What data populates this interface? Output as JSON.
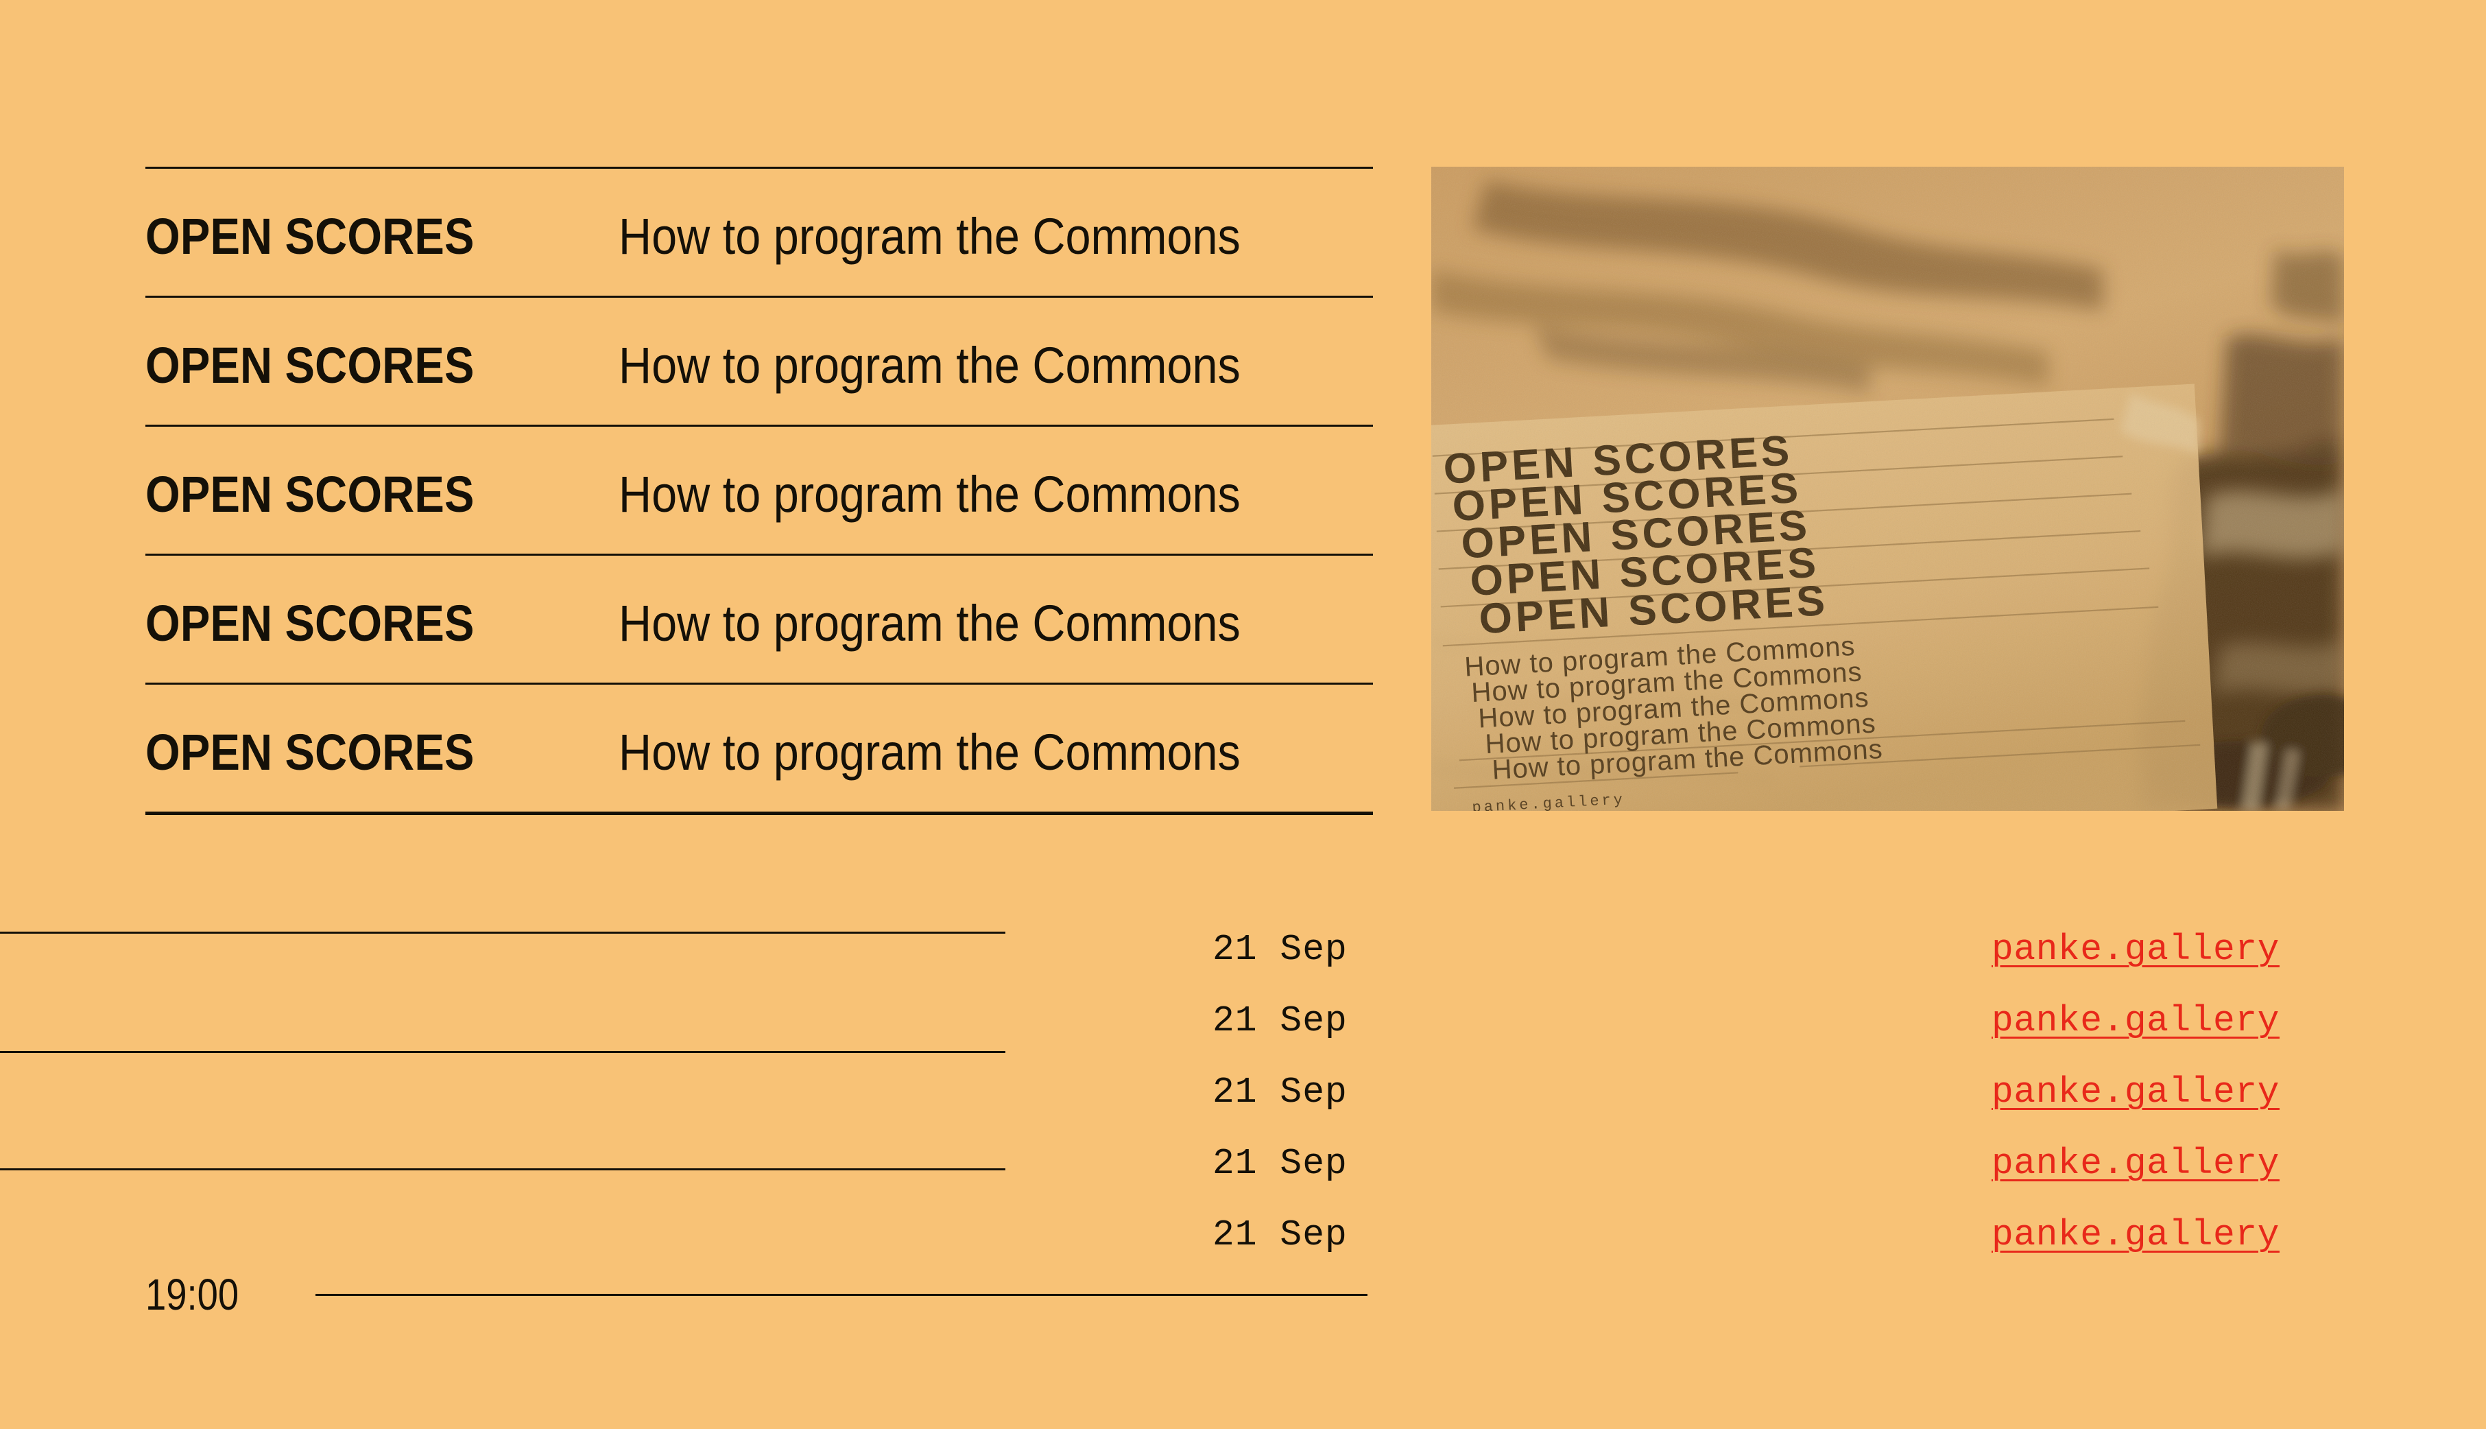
{
  "page": {
    "background_color": "#f8c276",
    "ink_color": "#141008",
    "accent_color": "#e8281a"
  },
  "masthead": {
    "rows": [
      {
        "title": "OPEN SCORES",
        "subtitle": "How to program the Commons"
      },
      {
        "title": "OPEN SCORES",
        "subtitle": "How to program the Commons"
      },
      {
        "title": "OPEN SCORES",
        "subtitle": "How to program the Commons"
      },
      {
        "title": "OPEN SCORES",
        "subtitle": "How to program the Commons"
      },
      {
        "title": "OPEN SCORES",
        "subtitle": "How to program the Commons"
      }
    ]
  },
  "photo": {
    "alt": "Sepia grainy photograph of a printed flyer lying on sand",
    "flyer_titles": [
      "OPEN SCORES",
      "OPEN SCORES",
      "OPEN SCORES",
      "OPEN SCORES",
      "OPEN SCORES"
    ],
    "flyer_subtitles": [
      "How to program the Commons",
      "How to program the Commons",
      "How to program the Commons",
      "How to program the Commons",
      "How to program the Commons"
    ],
    "flyer_credit": "panke.gallery"
  },
  "dates": [
    "21 Sep",
    "21 Sep",
    "21 Sep",
    "21 Sep",
    "21 Sep"
  ],
  "links": [
    "panke.gallery",
    "panke.gallery",
    "panke.gallery",
    "panke.gallery",
    "panke.gallery"
  ],
  "footer": {
    "time": "19:00"
  }
}
